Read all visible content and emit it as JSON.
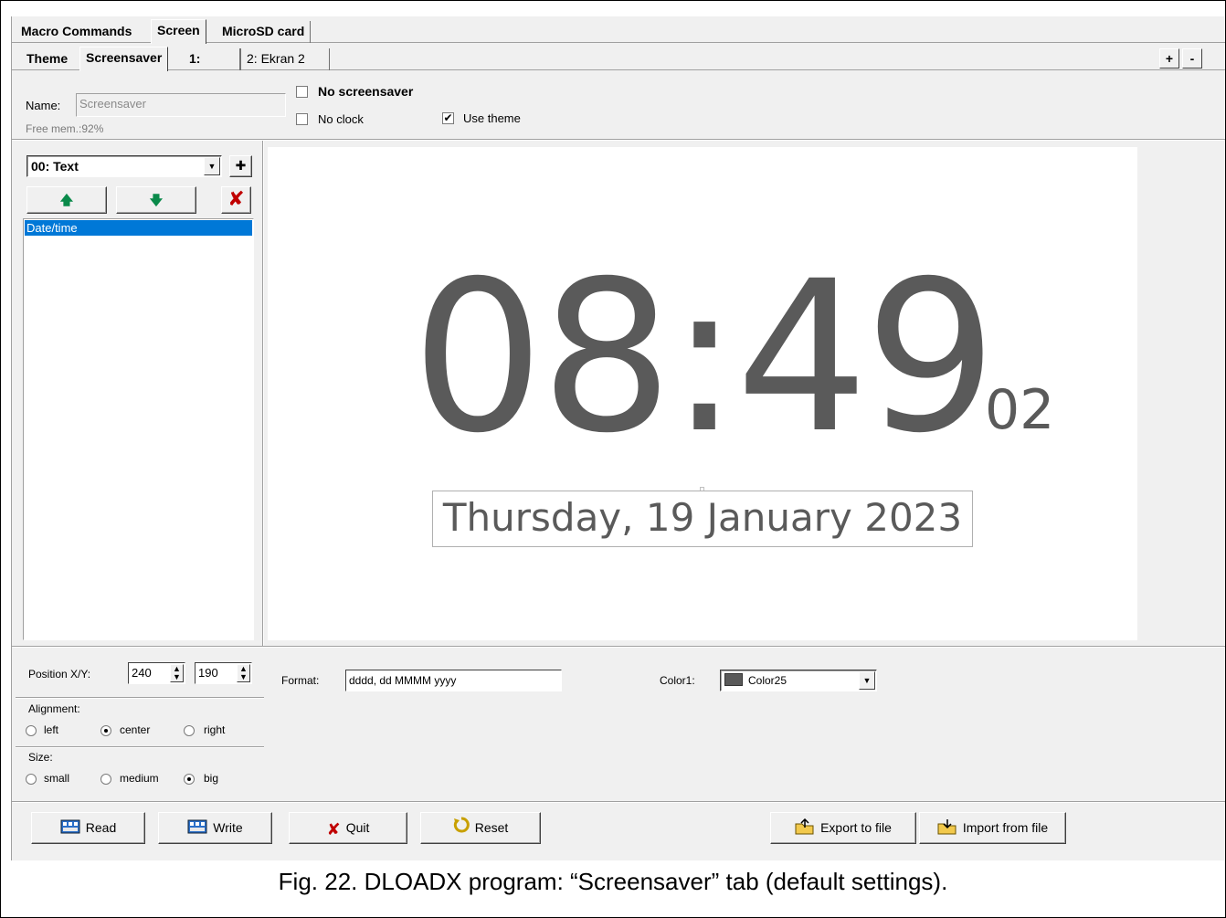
{
  "tabs_main": [
    {
      "label": "Macro Commands"
    },
    {
      "label": "Screen"
    },
    {
      "label": "MicroSD card"
    }
  ],
  "tabs_sub": [
    {
      "label": "Theme"
    },
    {
      "label": "Screensaver"
    },
    {
      "label": "1:"
    },
    {
      "label": "2: Ekran 2"
    }
  ],
  "tab_controls": {
    "plus": "+",
    "minus": "-"
  },
  "header": {
    "name_label": "Name:",
    "name_value": "Screensaver",
    "free_mem": "Free mem.:92%",
    "no_screensaver": "No screensaver",
    "no_clock": "No clock",
    "use_theme": "Use theme",
    "no_screensaver_checked": false,
    "no_clock_checked": false,
    "use_theme_checked": true
  },
  "element_panel": {
    "combo_value": "00: Text",
    "list_items": [
      "Date/time"
    ]
  },
  "preview": {
    "hours_minutes": "08:49",
    "seconds": "02",
    "date": "Thursday, 19 January 2023"
  },
  "properties": {
    "position_label": "Position X/Y:",
    "x": "240",
    "y": "190",
    "format_label": "Format:",
    "format_value": "dddd, dd MMMM yyyy",
    "color_label": "Color1:",
    "color_value": "Color25",
    "color_swatch": "#595959",
    "alignment_label": "Alignment:",
    "alignment_options": [
      "left",
      "center",
      "right"
    ],
    "alignment_selected": "center",
    "size_label": "Size:",
    "size_options": [
      "small",
      "medium",
      "big"
    ],
    "size_selected": "big"
  },
  "buttons": {
    "read": "Read",
    "write": "Write",
    "quit": "Quit",
    "reset": "Reset",
    "export": "Export to file",
    "import": "Import from file"
  },
  "caption": "Fig. 22. DLOADX program: “Screensaver” tab (default settings)."
}
